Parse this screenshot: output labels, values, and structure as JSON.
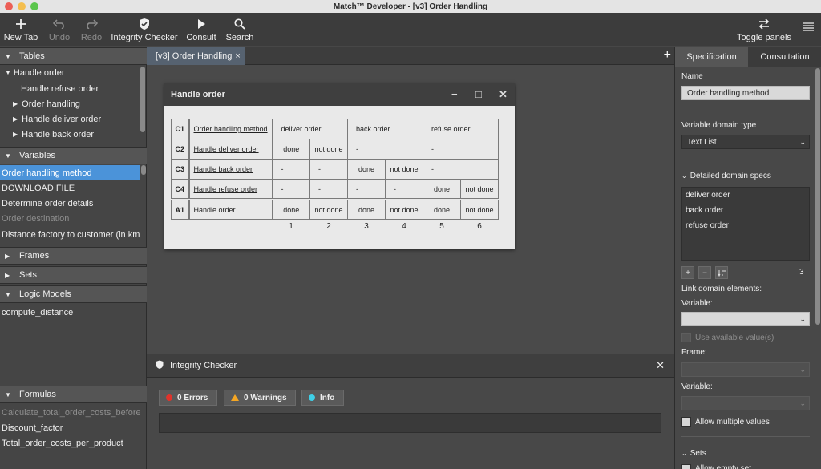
{
  "window": {
    "title": "Match™ Developer - [v3] Order Handling"
  },
  "toolbar": {
    "new_tab": "New Tab",
    "undo": "Undo",
    "redo": "Redo",
    "integrity_checker": "Integrity Checker",
    "consult": "Consult",
    "search": "Search",
    "toggle_panels": "Toggle panels",
    "icons": {
      "new_tab": "plus-icon",
      "undo": "undo-icon",
      "redo": "redo-icon",
      "integrity_checker": "shield-icon",
      "consult": "play-icon",
      "search": "search-icon",
      "toggle_panels": "swap-arrows-icon",
      "menu": "hamburger-menu-icon"
    }
  },
  "left_panel": {
    "tables": {
      "header": "Tables",
      "items": [
        {
          "label": "Handle order",
          "expanded": true
        },
        {
          "label": "Handle refuse order"
        },
        {
          "label": "Order handling"
        },
        {
          "label": "Handle deliver order"
        },
        {
          "label": "Handle back order"
        }
      ]
    },
    "variables": {
      "header": "Variables",
      "items": [
        {
          "label": "Order handling method",
          "selected": true
        },
        {
          "label": "DOWNLOAD FILE"
        },
        {
          "label": "Determine order details"
        },
        {
          "label": "Order destination",
          "dim": true
        },
        {
          "label": "Distance factory to customer (in km)"
        }
      ]
    },
    "frames": {
      "header": "Frames"
    },
    "sets": {
      "header": "Sets"
    },
    "logic_models": {
      "header": "Logic Models",
      "items": [
        {
          "label": "compute_distance"
        }
      ]
    },
    "formulas": {
      "header": "Formulas",
      "items": [
        {
          "label": "Calculate_total_order_costs_before...",
          "dim": true
        },
        {
          "label": "Discount_factor"
        },
        {
          "label": "Total_order_costs_per_product"
        }
      ]
    }
  },
  "center": {
    "tab_label": "[v3] Order Handling",
    "tab_close": "×",
    "add_tab": "+",
    "decision_window": {
      "title": "Handle order",
      "controls": {
        "minimize": "−",
        "maximize": "□",
        "close": "✕"
      },
      "conditions": [
        {
          "id": "C1",
          "name": "Order handling method",
          "underline": true,
          "cells": [
            {
              "text": "deliver order",
              "span": 2
            },
            {
              "text": "back order",
              "span": 2
            },
            {
              "text": "refuse order",
              "span": 2
            }
          ]
        },
        {
          "id": "C2",
          "name": "Handle deliver order",
          "underline": true,
          "cells": [
            {
              "text": "done",
              "span": 1
            },
            {
              "text": "not done",
              "span": 1
            },
            {
              "text": "-",
              "span": 2
            },
            {
              "text": "-",
              "span": 2
            }
          ]
        },
        {
          "id": "C3",
          "name": "Handle back order",
          "underline": true,
          "cells": [
            {
              "text": "-",
              "span": 1
            },
            {
              "text": "-",
              "span": 1
            },
            {
              "text": "done",
              "span": 1
            },
            {
              "text": "not done",
              "span": 1
            },
            {
              "text": "-",
              "span": 2
            }
          ]
        },
        {
          "id": "C4",
          "name": "Handle refuse order",
          "underline": true,
          "cells": [
            {
              "text": "-",
              "span": 1
            },
            {
              "text": "-",
              "span": 1
            },
            {
              "text": "-",
              "span": 1
            },
            {
              "text": "-",
              "span": 1
            },
            {
              "text": "done",
              "span": 1
            },
            {
              "text": "not done",
              "span": 1
            }
          ]
        }
      ],
      "action": {
        "id": "A1",
        "name": "Handle order",
        "cells": [
          "done",
          "not done",
          "done",
          "not done",
          "done",
          "not done"
        ]
      },
      "column_numbers": [
        "1",
        "2",
        "3",
        "4",
        "5",
        "6"
      ]
    },
    "integrity_checker": {
      "title": "Integrity Checker",
      "close": "✕",
      "errors": "0 Errors",
      "warnings": "0 Warnings",
      "info": "Info",
      "colors": {
        "error": "#e0332b",
        "warning": "#f5a623",
        "info": "#3fd0e8"
      }
    }
  },
  "right_panel": {
    "tabs": {
      "specification": "Specification",
      "consultation": "Consultation"
    },
    "name_label": "Name",
    "name_value": "Order handling method",
    "domain_type_label": "Variable domain type",
    "domain_type_value": "Text List",
    "detailed_specs_label": "Detailed domain specs",
    "domain_items": [
      "deliver order",
      "back order",
      "refuse order"
    ],
    "item_count": "3",
    "list_buttons": {
      "add": "+",
      "remove": "−",
      "sort": "sort-icon"
    },
    "link_label": "Link domain elements:",
    "variable_label": "Variable:",
    "use_available": "Use available value(s)",
    "frame_label": "Frame:",
    "variable2_label": "Variable:",
    "allow_multiple": "Allow multiple values",
    "sets_label": "Sets",
    "allow_empty": "Allow empty set"
  }
}
